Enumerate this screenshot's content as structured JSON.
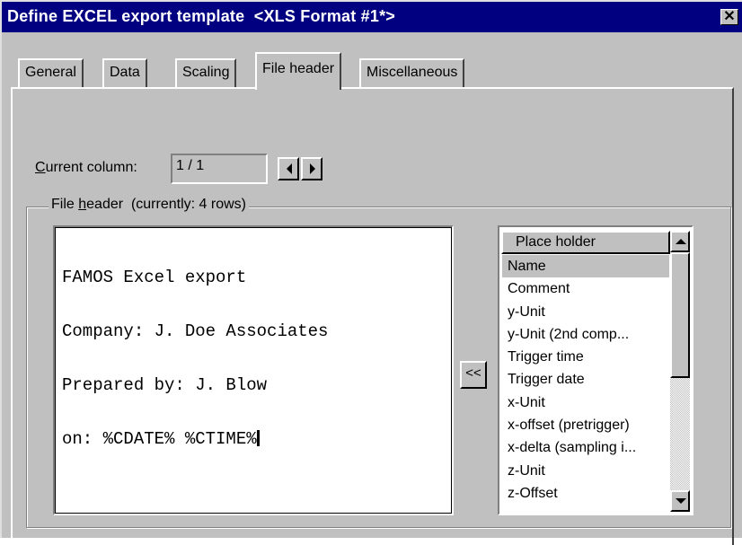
{
  "window": {
    "title": "Define EXCEL export template  <XLS Format #1*>",
    "close_label": "✕"
  },
  "tabs": [
    {
      "label": "General",
      "active": false
    },
    {
      "label": "Data",
      "active": false
    },
    {
      "label": "Scaling",
      "active": false
    },
    {
      "label": "File header",
      "active": true
    },
    {
      "label": "Miscellaneous",
      "active": false
    }
  ],
  "current_column": {
    "label_hotkey": "C",
    "label_rest": "urrent column:",
    "value": "1 / 1",
    "prev_icon": "triangle-left-icon",
    "next_icon": "triangle-right-icon"
  },
  "file_header": {
    "legend_pre": "File ",
    "legend_hotkey": "h",
    "legend_post": "eader  (currently: 4 rows)",
    "lines": [
      "FAMOS Excel export",
      "Company: J. Doe Associates",
      "Prepared by: J. Blow",
      "on: %CDATE% %CTIME%"
    ],
    "insert_label": "<<"
  },
  "placeholder_list": {
    "header": "Place holder",
    "items": [
      "Name",
      "Comment",
      "y-Unit",
      "y-Unit (2nd comp...",
      "Trigger time",
      "Trigger date",
      "x-Unit",
      "x-offset (pretrigger)",
      "x-delta (sampling i...",
      "z-Unit",
      "z-Offset"
    ],
    "selected_index": 0,
    "scroll_up_icon": "triangle-up-icon",
    "scroll_down_icon": "triangle-down-icon"
  }
}
